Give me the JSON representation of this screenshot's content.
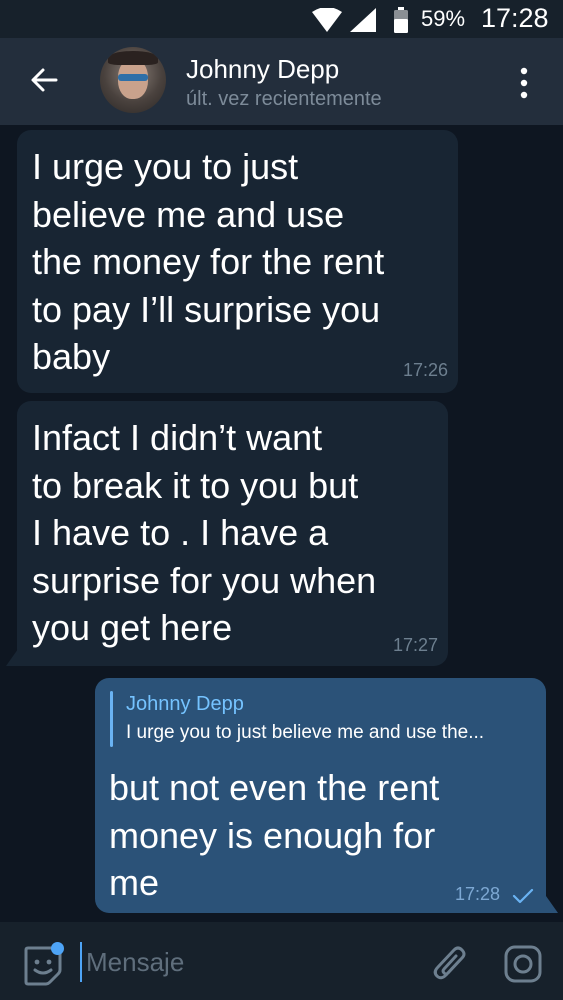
{
  "status_bar": {
    "battery": "59%",
    "time": "17:28"
  },
  "header": {
    "contact_name": "Johnny Depp",
    "last_seen": "últ. vez recientemente"
  },
  "messages": [
    {
      "direction": "incoming",
      "text": "I urge you to just\nbelieve me and use\nthe money for the rent\nto pay I’ll surprise you\nbaby",
      "time": "17:26"
    },
    {
      "direction": "incoming",
      "text": "Infact I didn’t want\nto break it to you but\nI have to . I have a\nsurprise for you when\nyou get here",
      "time": "17:27"
    },
    {
      "direction": "outgoing",
      "reply": {
        "name": "Johnny Depp",
        "text": "I urge you to just believe me and use the..."
      },
      "text": "but not even the rent\nmoney is enough for\nme",
      "time": "17:28",
      "status": "sent-check-icon"
    }
  ],
  "input": {
    "placeholder": "Mensaje"
  },
  "colors": {
    "background": "#0e1621",
    "header": "#232e3c",
    "incoming_bubble": "#182533",
    "outgoing_bubble": "#2b5278",
    "accent": "#6ab3f3"
  }
}
